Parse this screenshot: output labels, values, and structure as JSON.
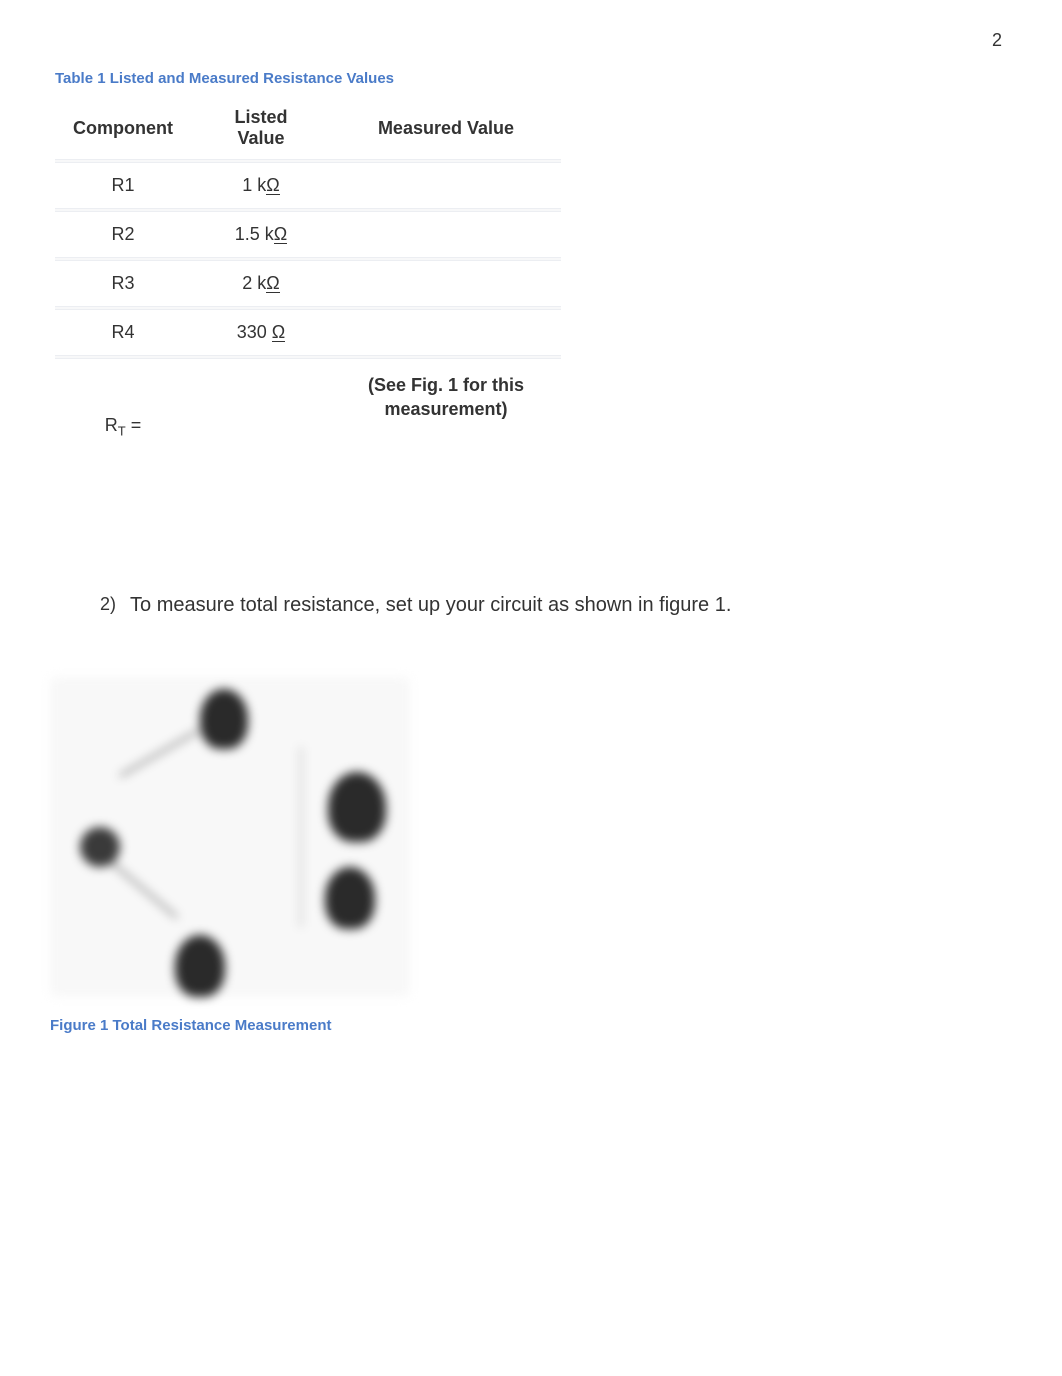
{
  "page_number": "2",
  "table_caption": "Table 1 Listed and Measured Resistance Values",
  "table": {
    "headers": {
      "component": "Component",
      "listed": "Listed Value",
      "measured": "Measured Value"
    },
    "rows": [
      {
        "component": "R1",
        "listed_prefix": "1 k",
        "listed_omega": "Ω",
        "measured": ""
      },
      {
        "component": "R2",
        "listed_prefix": "1.5 k",
        "listed_omega": "Ω",
        "measured": ""
      },
      {
        "component": "R3",
        "listed_prefix": "2 k",
        "listed_omega": "Ω",
        "measured": ""
      },
      {
        "component": "R4",
        "listed_prefix": "330 ",
        "listed_omega": "Ω",
        "measured": ""
      }
    ],
    "total_row": {
      "label_prefix": "R",
      "label_sub": "T",
      "label_suffix": " =",
      "listed": "",
      "measured_note": "(See Fig. 1 for this measurement)"
    }
  },
  "step": {
    "number": "2)",
    "text": "To measure total resistance, set up your circuit as shown in figure 1."
  },
  "figure_caption": "Figure 1 Total Resistance Measurement"
}
